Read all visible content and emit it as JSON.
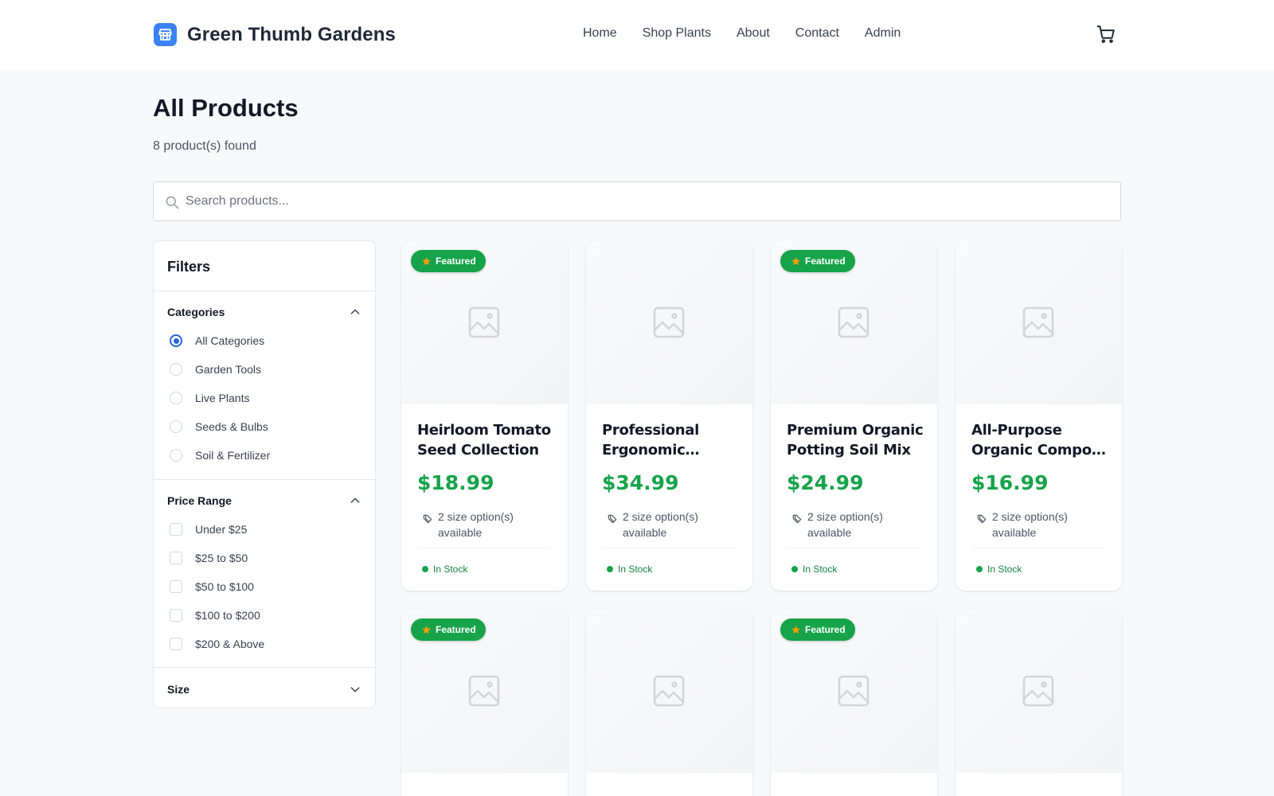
{
  "brand": {
    "name": "Green Thumb Gardens",
    "icon": "store-icon",
    "icon_color": "#3b82f6"
  },
  "nav": [
    {
      "label": "Home"
    },
    {
      "label": "Shop Plants"
    },
    {
      "label": "About"
    },
    {
      "label": "Contact"
    },
    {
      "label": "Admin"
    }
  ],
  "page": {
    "title": "All Products",
    "count": "8 product(s) found"
  },
  "search": {
    "placeholder": "Search products...",
    "value": ""
  },
  "filters": {
    "title": "Filters",
    "categories": {
      "title": "Categories",
      "expanded": true,
      "selected": "All Categories",
      "options": [
        "All Categories",
        "Garden Tools",
        "Live Plants",
        "Seeds & Bulbs",
        "Soil & Fertilizer"
      ]
    },
    "price": {
      "title": "Price Range",
      "expanded": true,
      "options": [
        "Under $25",
        "$25 to $50",
        "$50 to $100",
        "$100 to $200",
        "$200 & Above"
      ]
    },
    "size": {
      "title": "Size",
      "expanded": false
    }
  },
  "colors": {
    "accent": "#16a34a",
    "selected": "#2563eb"
  },
  "products": [
    {
      "name": "Heirloom Tomato Seed Collection",
      "price": "$18.99",
      "featured": true,
      "sizes": "2 size option(s) available",
      "stock": "In Stock"
    },
    {
      "name": "Professional Ergonomic Pruning Shears",
      "price": "$34.99",
      "featured": false,
      "sizes": "2 size option(s) available",
      "stock": "In Stock"
    },
    {
      "name": "Premium Organic Potting Soil Mix",
      "price": "$24.99",
      "featured": true,
      "sizes": "2 size option(s) available",
      "stock": "In Stock"
    },
    {
      "name": "All-Purpose Organic Compost Blend",
      "price": "$16.99",
      "featured": false,
      "sizes": "2 size option(s) available",
      "stock": "In Stock"
    },
    {
      "name": "",
      "price": "",
      "featured": true,
      "sizes": "",
      "stock": ""
    },
    {
      "name": "",
      "price": "",
      "featured": false,
      "sizes": "",
      "stock": ""
    },
    {
      "name": "",
      "price": "",
      "featured": true,
      "sizes": "",
      "stock": ""
    },
    {
      "name": "",
      "price": "",
      "featured": false,
      "sizes": "",
      "stock": ""
    }
  ],
  "badge_label": "Featured"
}
